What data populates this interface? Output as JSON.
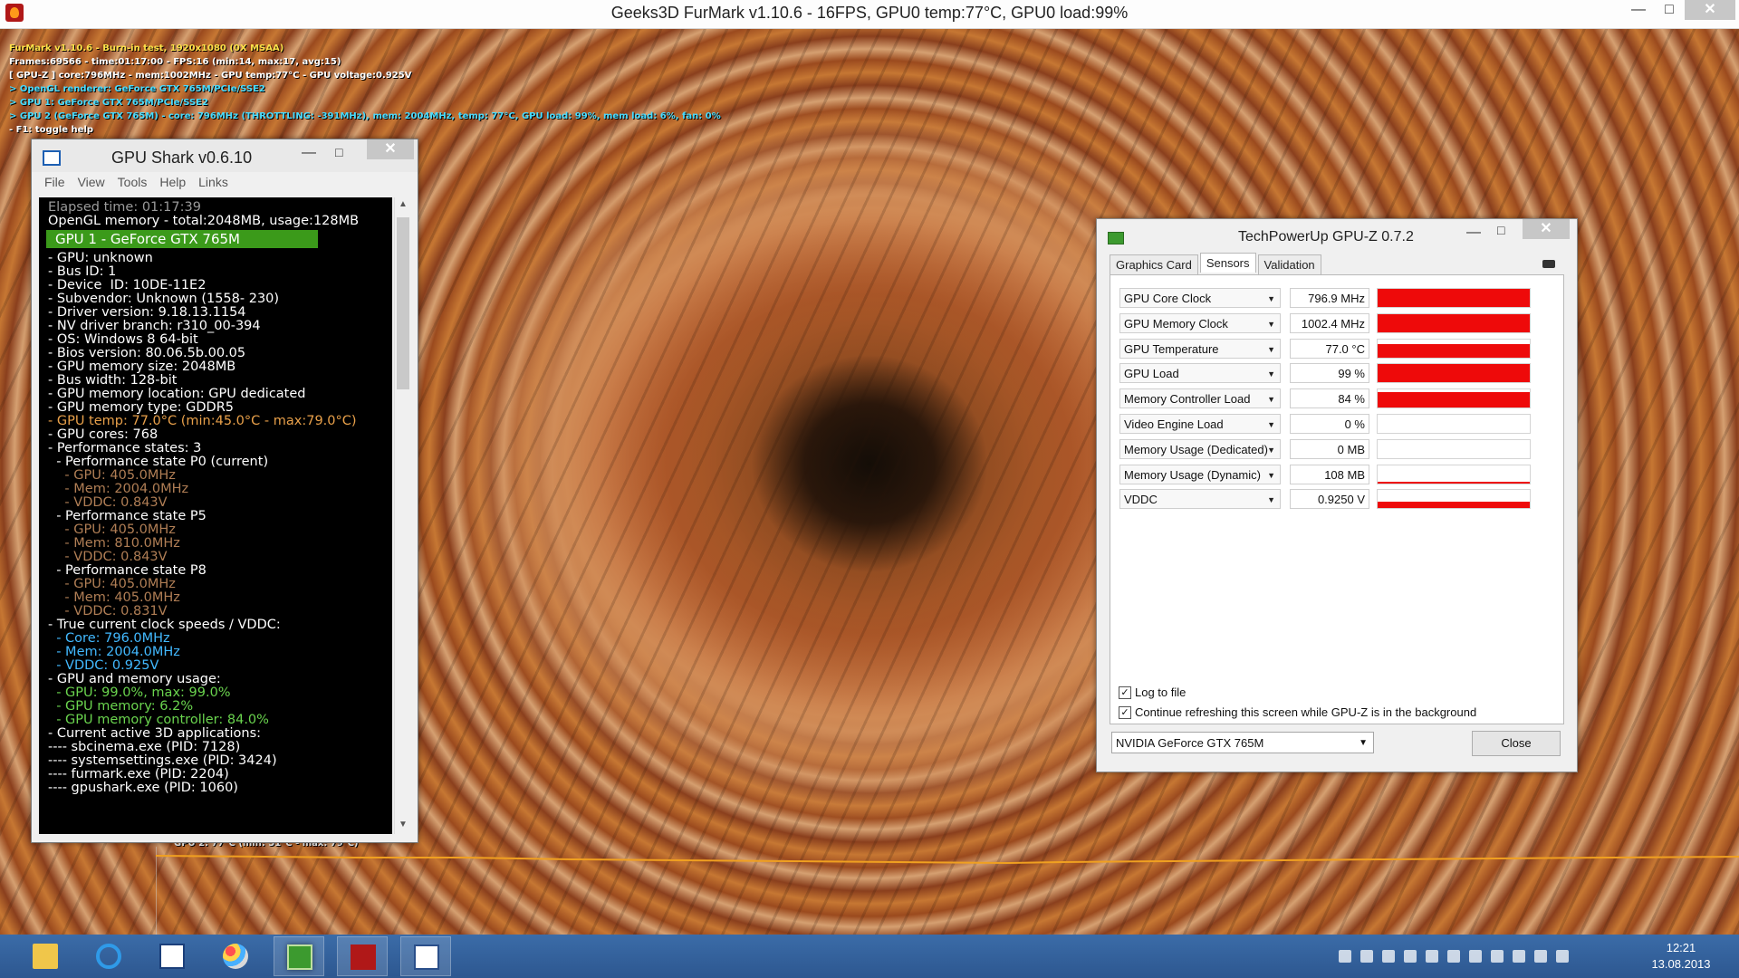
{
  "furmark": {
    "window_title": "Geeks3D FurMark v1.10.6 - 16FPS, GPU0 temp:77°C, GPU0 load:99%",
    "osd": {
      "line1": "FurMark v1.10.6 - Burn-in test, 1920x1080 (0X MSAA)",
      "line2": "Frames:69566 - time:01:17:00 - FPS:16 (min:14, max:17, avg:15)",
      "line3": "[ GPU-Z ] core:796MHz - mem:1002MHz - GPU temp:77°C - GPU voltage:0.925V",
      "line4": "> OpenGL renderer: GeForce GTX 765M/PCIe/SSE2",
      "line5": "> GPU 1: GeForce GTX 765M/PCIe/SSE2",
      "line6": "> GPU 2 (GeForce GTX 765M) - core: 796MHz (THROTTLING: -391MHz), mem: 2004MHz, temp: 77°C, GPU load: 99%, mem load: 6%, fan: 0%",
      "line7": "- F1: toggle help"
    },
    "graph_label": "GPU 2: 77°C (min: 51°C - max: 79°C)",
    "graph_color": "#f0a020"
  },
  "gpushark": {
    "title": "GPU Shark v0.6.10",
    "menu": [
      "File",
      "View",
      "Tools",
      "Help",
      "Links"
    ],
    "gpu_header": "GPU 1 - GeForce GTX 765M",
    "lines": [
      {
        "t": "Elapsed time: 01:17:39",
        "c": "gray"
      },
      {
        "t": "OpenGL memory - total:2048MB, usage:128MB",
        "c": "white"
      },
      {
        "t": "- GPU: unknown",
        "c": "white"
      },
      {
        "t": "- Bus ID: 1",
        "c": "white"
      },
      {
        "t": "- Device  ID: 10DE-11E2",
        "c": "white"
      },
      {
        "t": "- Subvendor: Unknown (1558- 230)",
        "c": "white"
      },
      {
        "t": "- Driver version: 9.18.13.1154",
        "c": "white"
      },
      {
        "t": "- NV driver branch: r310_00-394",
        "c": "white"
      },
      {
        "t": "- OS: Windows 8 64-bit",
        "c": "white"
      },
      {
        "t": "- Bios version: 80.06.5b.00.05",
        "c": "white"
      },
      {
        "t": "- GPU memory size: 2048MB",
        "c": "white"
      },
      {
        "t": "- Bus width: 128-bit",
        "c": "white"
      },
      {
        "t": "- GPU memory location: GPU dedicated",
        "c": "white"
      },
      {
        "t": "- GPU memory type: GDDR5",
        "c": "white"
      },
      {
        "t": "- GPU temp: 77.0°C (min:45.0°C - max:79.0°C)",
        "c": "orange"
      },
      {
        "t": "- GPU cores: 768",
        "c": "white"
      },
      {
        "t": "- Performance states: 3",
        "c": "white"
      },
      {
        "t": "  - Performance state P0 (current)",
        "c": "white"
      },
      {
        "t": "    - GPU: 405.0MHz",
        "c": "brown"
      },
      {
        "t": "    - Mem: 2004.0MHz",
        "c": "brown"
      },
      {
        "t": "    - VDDC: 0.843V",
        "c": "brown"
      },
      {
        "t": "  - Performance state P5",
        "c": "white"
      },
      {
        "t": "    - GPU: 405.0MHz",
        "c": "brown"
      },
      {
        "t": "    - Mem: 810.0MHz",
        "c": "brown"
      },
      {
        "t": "    - VDDC: 0.843V",
        "c": "brown"
      },
      {
        "t": "  - Performance state P8",
        "c": "white"
      },
      {
        "t": "    - GPU: 405.0MHz",
        "c": "brown"
      },
      {
        "t": "    - Mem: 405.0MHz",
        "c": "brown"
      },
      {
        "t": "    - VDDC: 0.831V",
        "c": "brown"
      },
      {
        "t": "- True current clock speeds / VDDC:",
        "c": "white"
      },
      {
        "t": "  - Core: 796.0MHz",
        "c": "cyan"
      },
      {
        "t": "  - Mem: 2004.0MHz",
        "c": "cyan"
      },
      {
        "t": "  - VDDC: 0.925V",
        "c": "cyan"
      },
      {
        "t": "- GPU and memory usage:",
        "c": "white"
      },
      {
        "t": "  - GPU: 99.0%, max: 99.0%",
        "c": "green"
      },
      {
        "t": "  - GPU memory: 6.2%",
        "c": "green"
      },
      {
        "t": "  - GPU memory controller: 84.0%",
        "c": "green"
      },
      {
        "t": "- Current active 3D applications:",
        "c": "white"
      },
      {
        "t": "---- sbcinema.exe (PID: 7128)",
        "c": "white"
      },
      {
        "t": "---- systemsettings.exe (PID: 3424)",
        "c": "white"
      },
      {
        "t": "---- furmark.exe (PID: 2204)",
        "c": "white"
      },
      {
        "t": "---- gpushark.exe (PID: 1060)",
        "c": "white"
      }
    ]
  },
  "gpuz": {
    "title": "TechPowerUp GPU-Z 0.7.2",
    "tabs": [
      "Graphics Card",
      "Sensors",
      "Validation"
    ],
    "active_tab": "Sensors",
    "sensors": [
      {
        "name": "GPU Core Clock",
        "value": "796.9 MHz",
        "level": 1.0
      },
      {
        "name": "GPU Memory Clock",
        "value": "1002.4 MHz",
        "level": 1.0
      },
      {
        "name": "GPU Temperature",
        "value": "77.0 °C",
        "level": 0.77
      },
      {
        "name": "GPU Load",
        "value": "99 %",
        "level": 0.99
      },
      {
        "name": "Memory Controller Load",
        "value": "84 %",
        "level": 0.84
      },
      {
        "name": "Video Engine Load",
        "value": "0 %",
        "level": 0.0
      },
      {
        "name": "Memory Usage (Dedicated)",
        "value": "0 MB",
        "level": 0.0
      },
      {
        "name": "Memory Usage (Dynamic)",
        "value": "108 MB",
        "level": 0.1
      },
      {
        "name": "VDDC",
        "value": "0.9250 V",
        "level": 0.3
      }
    ],
    "log_to_file": "Log to file",
    "continue_refresh": "Continue refreshing this screen while GPU-Z is in the background",
    "adapter": "NVIDIA GeForce GTX 765M",
    "close_label": "Close",
    "bar_color": "#ee0a0a"
  },
  "taskbar": {
    "apps": [
      "file-explorer",
      "internet-explorer",
      "gpu-caps-viewer",
      "paint",
      "gpu-z",
      "furmark",
      "gpu-shark"
    ],
    "time": "12:21",
    "date": "13.08.2013"
  }
}
